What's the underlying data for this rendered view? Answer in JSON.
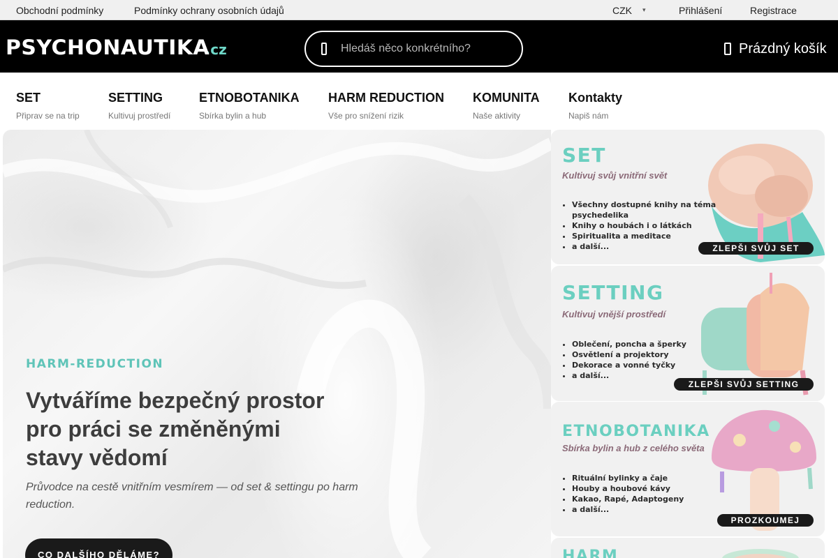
{
  "topbar": {
    "links": [
      "Obchodní podmínky",
      "Podmínky ochrany osobních údajů"
    ],
    "currency": "CZK",
    "login": "Přihlášení",
    "register": "Registrace"
  },
  "header": {
    "logo_main": "PSYCHONAUTIKA",
    "logo_domain": ".cz",
    "search_placeholder": "Hledáš něco konkrétního?",
    "cart_label": "Prázdný košík"
  },
  "nav": [
    {
      "title": "SET",
      "subtitle": "Připrav se na trip"
    },
    {
      "title": "SETTING",
      "subtitle": "Kultivuj prostředí"
    },
    {
      "title": "ETNOBOTANIKA",
      "subtitle": "Sbírka bylin a hub"
    },
    {
      "title": "HARM REDUCTION",
      "subtitle": "Vše pro snížení rizik"
    },
    {
      "title": "KOMUNITA",
      "subtitle": "Naše aktivity"
    },
    {
      "title": "Kontakty",
      "subtitle": "Napiš nám"
    }
  ],
  "hero": {
    "tag": "HARM-REDUCTION",
    "title_lines": [
      "Vytváříme bezpečný prostor",
      "pro práci se změněnými",
      "stavy vědomí"
    ],
    "subtitle": "Průvodce na cestě vnitřním vesmírem — od set & settingu po harm reduction.",
    "button": "CO DALŠÍHO DĚLÁME?"
  },
  "cards": [
    {
      "heading": "SET",
      "subheading": "Kultivuj svůj vnitřní svět",
      "items": [
        "Všechny dostupné knihy na téma psychedelika",
        "Knihy o houbách i o látkách",
        "Spiritualita a meditace",
        "a další..."
      ],
      "button": "ZLEPŠI SVŮJ SET"
    },
    {
      "heading": "SETTING",
      "subheading": "Kultivuj vnější prostředí",
      "items": [
        "Oblečení, poncha a šperky",
        "Osvětlení a projektory",
        "Dekorace a vonné tyčky",
        "a další..."
      ],
      "button": "ZLEPŠI SVŮJ SETTING"
    },
    {
      "heading": "ETNOBOTANIKA",
      "subheading": "Sbírka bylin a hub z celého světa",
      "items": [
        "Rituální bylinky a čaje",
        "Houby a houbové kávy",
        "Kakao, Rapé, Adaptogeny",
        "a další..."
      ],
      "button": "PROZKOUMEJ"
    },
    {
      "heading": "HARM"
    }
  ],
  "colors": {
    "accent": "#6bcfc0",
    "subheading": "#8b6a78",
    "header_bg": "#000000",
    "button_bg": "#1a1a1a"
  },
  "icons": {
    "search": "search-icon",
    "cart": "cart-icon",
    "currency_dropdown": "chevron-down-icon"
  }
}
